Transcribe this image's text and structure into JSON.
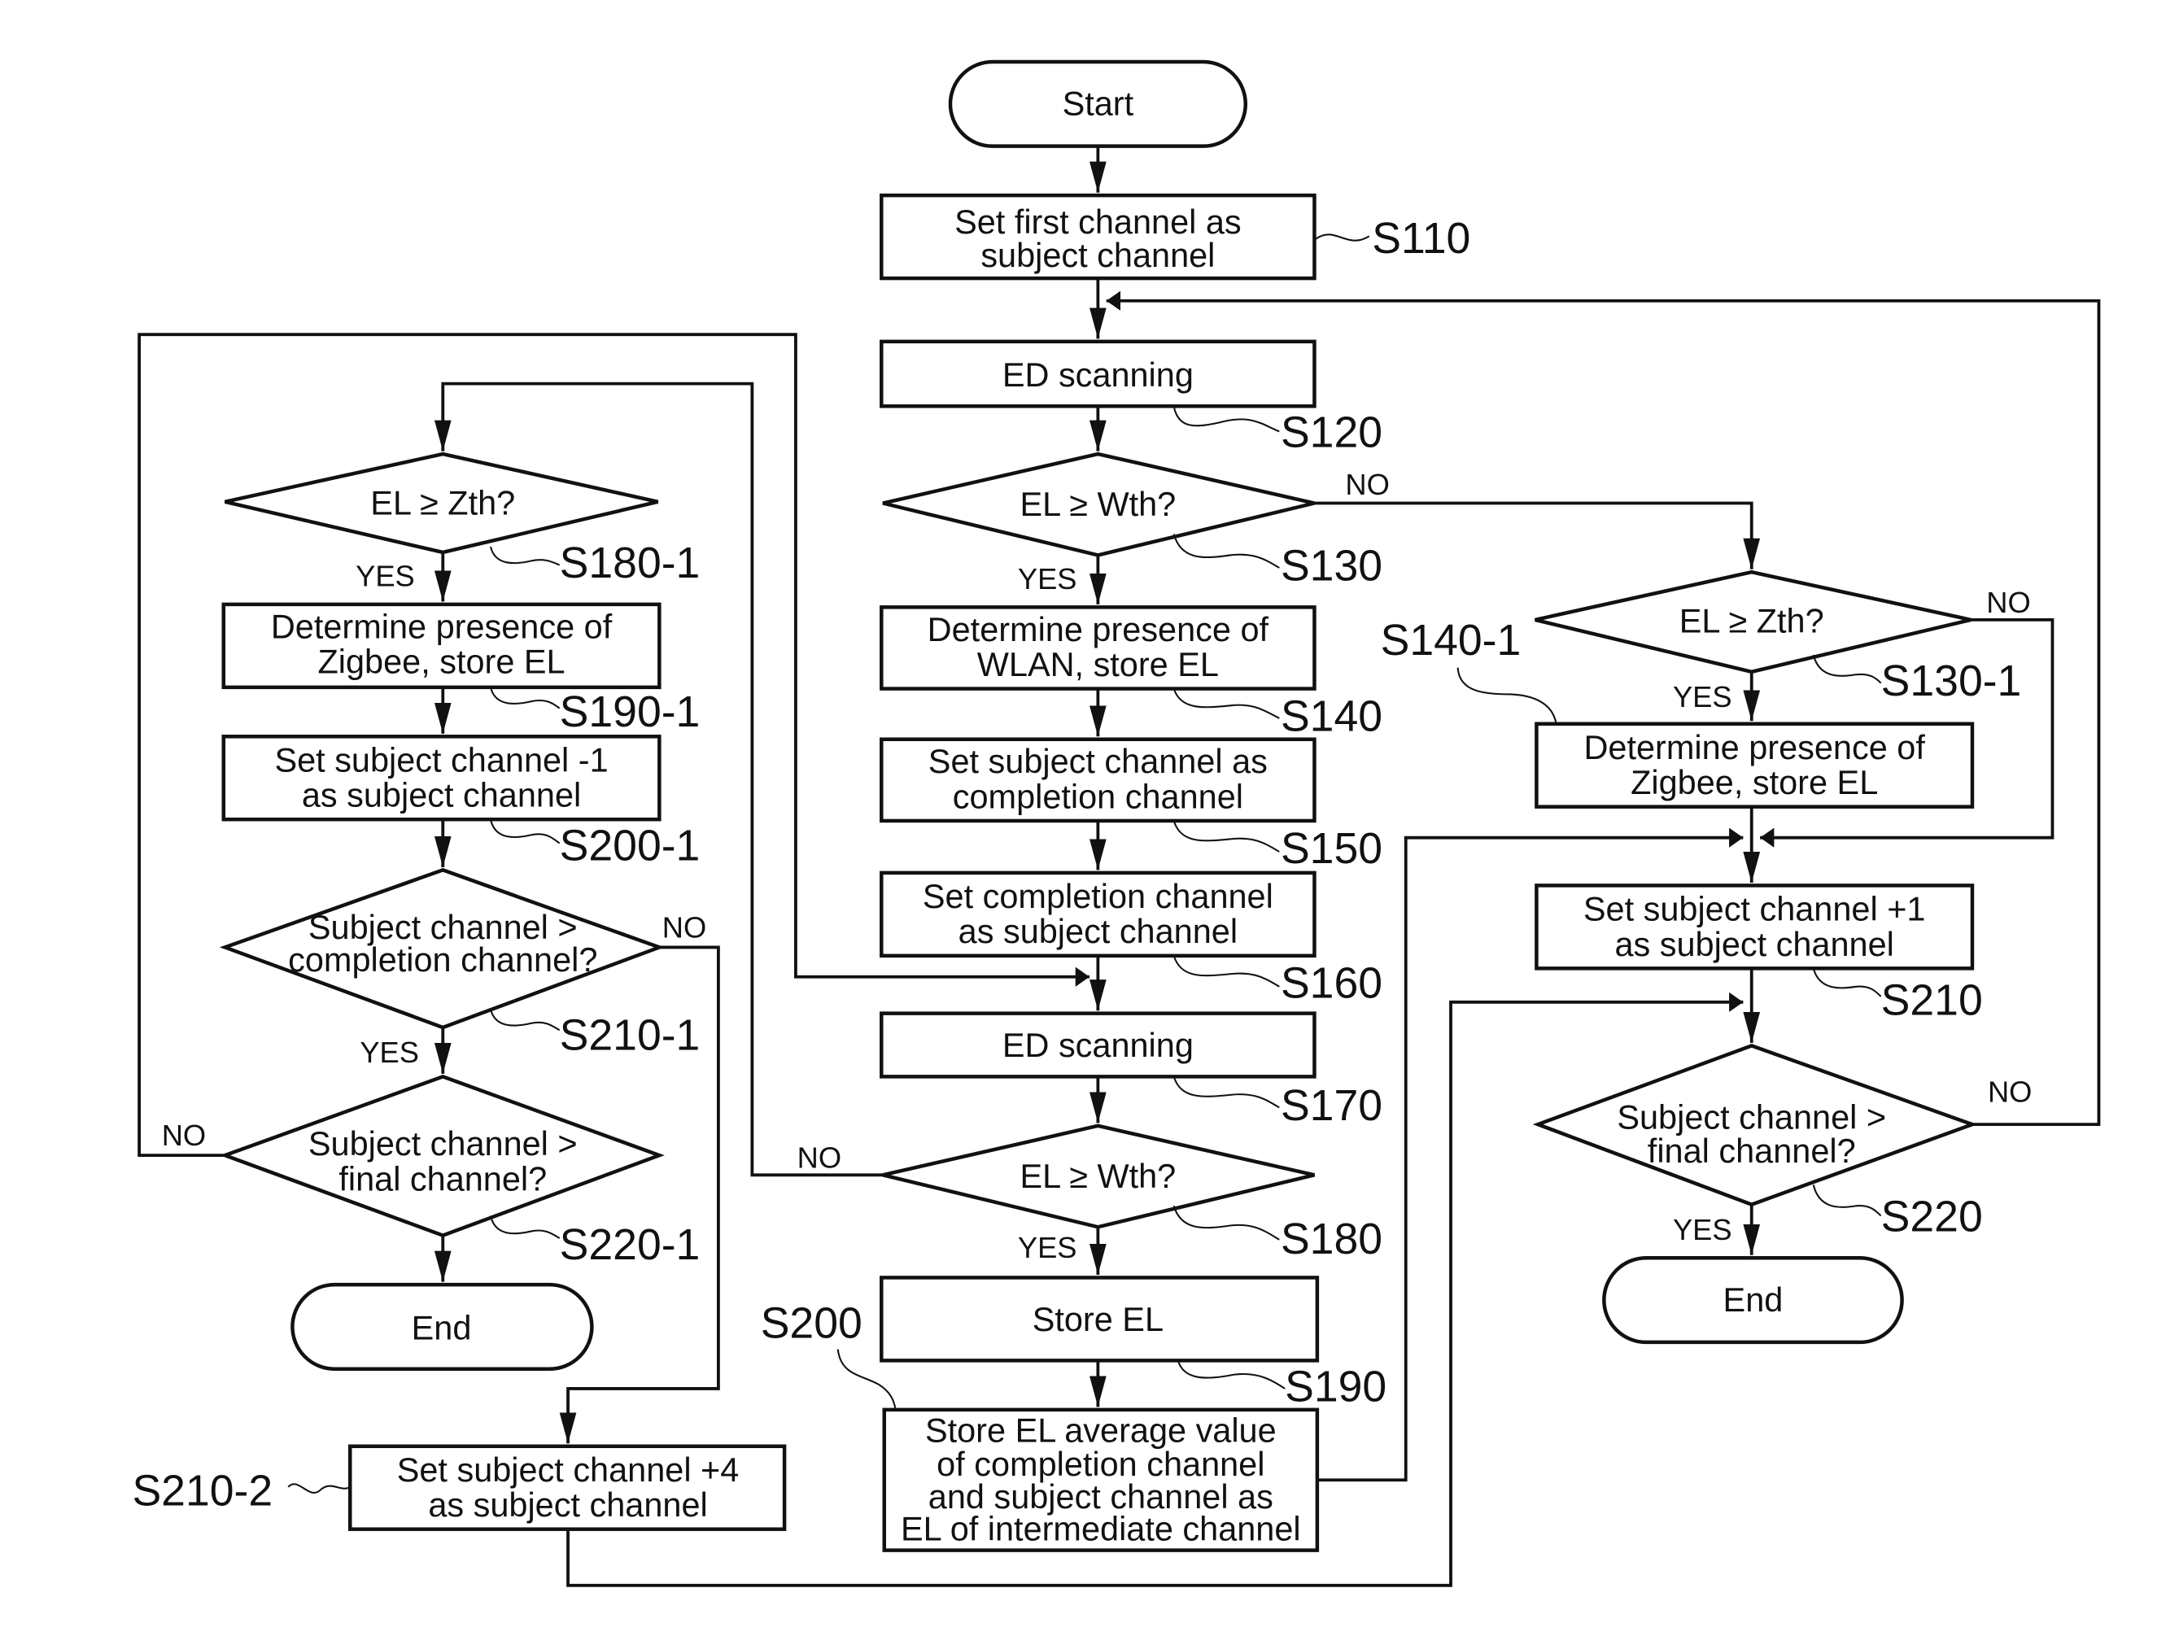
{
  "diagram": {
    "type": "flowchart",
    "colors": {
      "ink": "#111111",
      "background": "#ffffff"
    },
    "nodes": {
      "start": {
        "text": "Start"
      },
      "s110": {
        "lines": [
          "Set first channel as",
          "subject channel"
        ],
        "ref": "S110"
      },
      "s120": {
        "lines": [
          "ED scanning"
        ],
        "ref": "S120"
      },
      "s130": {
        "lines": [
          "EL ≥  Wth?"
        ],
        "ref": "S130"
      },
      "s140": {
        "lines": [
          "Determine presence of",
          "WLAN, store EL"
        ],
        "ref": "S140"
      },
      "s150": {
        "lines": [
          "Set subject channel as",
          "completion channel"
        ],
        "ref": "S150"
      },
      "s160": {
        "lines": [
          "Set completion channel",
          "as subject channel"
        ],
        "ref": "S160"
      },
      "s170": {
        "lines": [
          "ED scanning"
        ],
        "ref": "S170"
      },
      "s180": {
        "lines": [
          "EL ≥  Wth?"
        ],
        "ref": "S180"
      },
      "s190": {
        "lines": [
          "Store EL"
        ],
        "ref": "S190"
      },
      "s200": {
        "lines": [
          "Store EL average value",
          "of completion channel",
          "and subject channel as",
          "EL of intermediate channel"
        ],
        "ref": "S200"
      },
      "s130_1": {
        "lines": [
          "EL ≥  Zth?"
        ],
        "ref": "S130-1"
      },
      "s140_1": {
        "lines": [
          "Determine presence of",
          "Zigbee, store EL"
        ],
        "ref": "S140-1"
      },
      "s210": {
        "lines": [
          "Set subject channel +1",
          "as subject channel"
        ],
        "ref": "S210"
      },
      "s220": {
        "lines": [
          "Subject channel >",
          "final channel?"
        ],
        "ref": "S220"
      },
      "end_right": {
        "text": "End"
      },
      "s180_1": {
        "lines": [
          "EL ≥  Zth?"
        ],
        "ref": "S180-1"
      },
      "s190_1": {
        "lines": [
          "Determine presence of",
          "Zigbee, store EL"
        ],
        "ref": "S190-1"
      },
      "s200_1": {
        "lines": [
          "Set subject channel -1",
          "as subject channel"
        ],
        "ref": "S200-1"
      },
      "s210_1": {
        "lines": [
          "Subject channel >",
          "completion channel?"
        ],
        "ref": "S210-1"
      },
      "s220_1": {
        "lines": [
          "Subject channel >",
          "final channel?"
        ],
        "ref": "S220-1"
      },
      "end_left": {
        "text": "End"
      },
      "s210_2": {
        "lines": [
          "Set subject channel +4",
          "as subject channel"
        ],
        "ref": "S210-2"
      }
    },
    "branch_labels": {
      "yes": "YES",
      "no": "NO"
    }
  }
}
